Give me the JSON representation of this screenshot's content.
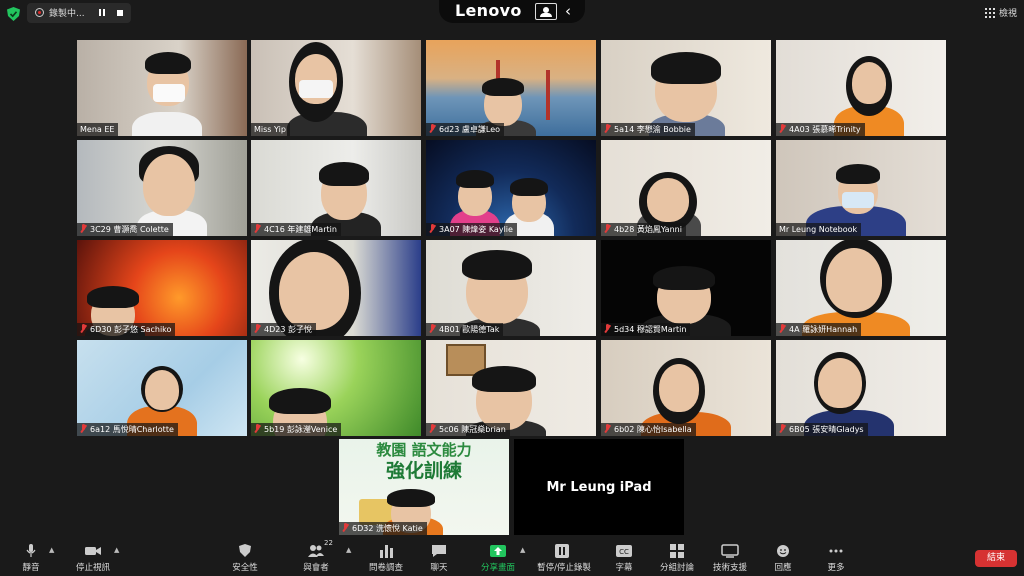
{
  "recording": {
    "label": "錄製中..."
  },
  "brand": {
    "name": "Lenovo"
  },
  "view": {
    "label": "檢視"
  },
  "participants": [
    {
      "name": "Mena EE",
      "muted": false
    },
    {
      "name": "Miss Yip",
      "muted": false,
      "speaking": true
    },
    {
      "name": "6d23 盧卓謙Leo",
      "muted": true
    },
    {
      "name": "5a14 李懋渝 Bobbie",
      "muted": true
    },
    {
      "name": "4A03 張慕晞Trinity",
      "muted": true
    },
    {
      "name": "3C29 曹灝喬 Colette",
      "muted": true
    },
    {
      "name": "4C16 年建雄Martin",
      "muted": true
    },
    {
      "name": "3A07 陳煒姿 Kaylie",
      "muted": true
    },
    {
      "name": "4b28 黃焰鳳Yanni",
      "muted": true
    },
    {
      "name": "Mr Leung Notebook",
      "muted": false
    },
    {
      "name": "6D30 彭子悠 Sachiko",
      "muted": true
    },
    {
      "name": "4D23 彭子悅",
      "muted": true
    },
    {
      "name": "4B01 歐陽德Tak",
      "muted": true
    },
    {
      "name": "5d34 穆認賢Martin",
      "muted": true
    },
    {
      "name": "4A 羅詠妍Hannah",
      "muted": true
    },
    {
      "name": "6a12 馬悅晴Charlotte",
      "muted": true
    },
    {
      "name": "5b19 彭詠瀅Venice",
      "muted": true
    },
    {
      "name": "5c06 陳冠燊brian",
      "muted": true
    },
    {
      "name": "6b02 陳心怡Isabella",
      "muted": true
    },
    {
      "name": "6B05 張安晴Gladys",
      "muted": true
    },
    {
      "name": "6D32 洗懷悅 Katie",
      "muted": true
    },
    {
      "name": "Mr Leung iPad",
      "muted": false,
      "video_off": true
    }
  ],
  "banner": {
    "line1": "教園 語文能力",
    "line2": "強化訓練"
  },
  "toolbar": {
    "mute": "靜音",
    "stop_video": "停止視訊",
    "security": "安全性",
    "participants": "與會者",
    "participants_count": "22",
    "polls": "問卷調查",
    "chat": "聊天",
    "share_screen": "分享畫面",
    "record": "暫停/停止錄製",
    "captions": "字幕",
    "breakout": "分組討論",
    "tech_support": "技術支援",
    "reactions": "回應",
    "more": "更多",
    "end": "結束"
  },
  "colors": {
    "share_green": "#22c55e",
    "end_red": "#d63232",
    "active_border": "#b9d64a",
    "muted_mic": "#e23a3a"
  }
}
